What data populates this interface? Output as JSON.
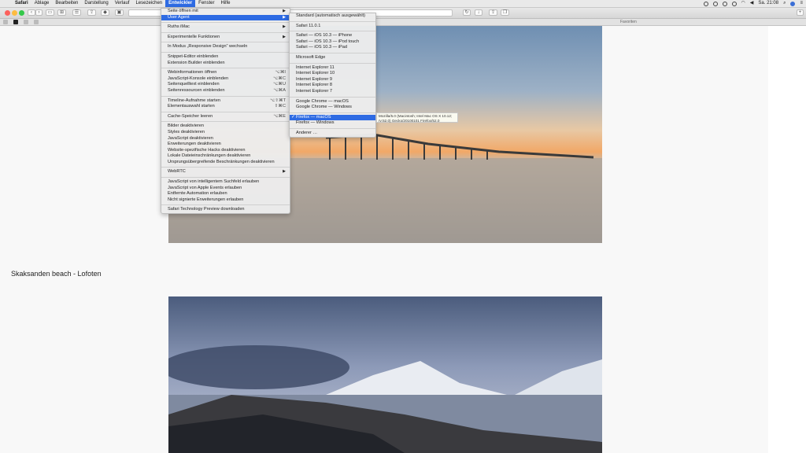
{
  "menubar": {
    "apple": "",
    "items": [
      "Safari",
      "Ablage",
      "Bearbeiten",
      "Darstellung",
      "Verlauf",
      "Lesezeichen",
      "Entwickler",
      "Fenster",
      "Hilfe"
    ],
    "active_index": 6,
    "clock": "Sa. 21:08"
  },
  "favorites_label": "Favoriten",
  "page": {
    "caption": "Skaksanden beach - Lofoten"
  },
  "develop_menu": {
    "items": [
      {
        "label": "Seite öffnen mit",
        "arrow": true
      },
      {
        "label": "User Agent",
        "arrow": true,
        "highlight": true
      },
      {
        "sep": true
      },
      {
        "label": "Ruths iMac",
        "arrow": true
      },
      {
        "sep": true
      },
      {
        "label": "Experimentelle Funktionen",
        "arrow": true
      },
      {
        "sep": true
      },
      {
        "label": "In Modus „Responsive Design“ wechseln"
      },
      {
        "sep": true
      },
      {
        "label": "Snippet-Editor einblenden"
      },
      {
        "label": "Extension Builder einblenden"
      },
      {
        "sep": true
      },
      {
        "label": "Webinformationen öffnen",
        "shortcut": "⌥⌘I"
      },
      {
        "label": "JavaScript-Konsole einblenden",
        "shortcut": "⌥⌘C"
      },
      {
        "label": "Seitenquelltext einblenden",
        "shortcut": "⌥⌘U"
      },
      {
        "label": "Seitenressourcen einblenden",
        "shortcut": "⌥⌘A"
      },
      {
        "sep": true
      },
      {
        "label": "Timeline-Aufnahme starten",
        "shortcut": "⌥⇧⌘T"
      },
      {
        "label": "Elementauswahl starten",
        "shortcut": "⇧⌘C"
      },
      {
        "sep": true
      },
      {
        "label": "Cache-Speicher leeren",
        "shortcut": "⌥⌘E"
      },
      {
        "sep": true
      },
      {
        "label": "Bilder deaktivieren"
      },
      {
        "label": "Styles deaktivieren"
      },
      {
        "label": "JavaScript deaktivieren"
      },
      {
        "label": "Erweiterungen deaktivieren"
      },
      {
        "label": "Website-spezifische Hacks deaktivieren"
      },
      {
        "label": "Lokale Dateieinschränkungen deaktivieren"
      },
      {
        "label": "Ursprungsübergreifende Beschränkungen deaktivieren"
      },
      {
        "sep": true
      },
      {
        "label": "WebRTC",
        "arrow": true
      },
      {
        "sep": true
      },
      {
        "label": "JavaScript von intelligentem Suchfeld erlauben"
      },
      {
        "label": "JavaScript von Apple Events erlauben"
      },
      {
        "label": "Entfernte Automation erlauben"
      },
      {
        "label": "Nicht signierte Erweiterungen erlauben"
      },
      {
        "sep": true
      },
      {
        "label": "Safari Technology Preview downloaden"
      }
    ]
  },
  "useragent_menu": {
    "items": [
      {
        "label": "Standard (automatisch ausgewählt)"
      },
      {
        "sep": true
      },
      {
        "label": "Safari 11.0.1"
      },
      {
        "sep": true
      },
      {
        "label": "Safari — iOS 10.3 — iPhone"
      },
      {
        "label": "Safari — iOS 10.3 — iPod touch"
      },
      {
        "label": "Safari — iOS 10.3 — iPad"
      },
      {
        "sep": true
      },
      {
        "label": "Microsoft Edge"
      },
      {
        "sep": true
      },
      {
        "label": "Internet Explorer 11"
      },
      {
        "label": "Internet Explorer 10"
      },
      {
        "label": "Internet Explorer 9"
      },
      {
        "label": "Internet Explorer 8"
      },
      {
        "label": "Internet Explorer 7"
      },
      {
        "sep": true
      },
      {
        "label": "Google Chrome — macOS"
      },
      {
        "label": "Google Chrome — Windows"
      },
      {
        "sep": true
      },
      {
        "label": "Firefox — macOS",
        "highlight": true,
        "checked": true
      },
      {
        "label": "Firefox — Windows"
      },
      {
        "sep": true
      },
      {
        "label": "Anderer …"
      }
    ]
  },
  "tooltip": "Mozilla/5.0 (Macintosh; Intel Mac OS X 10.12; rv:52.0) Gecko/20100101 Firefox/52.0",
  "colors": {
    "accent": "#2e6be3",
    "traffic_red": "#fc605c",
    "traffic_yellow": "#fdbc40",
    "traffic_green": "#34c84a"
  }
}
